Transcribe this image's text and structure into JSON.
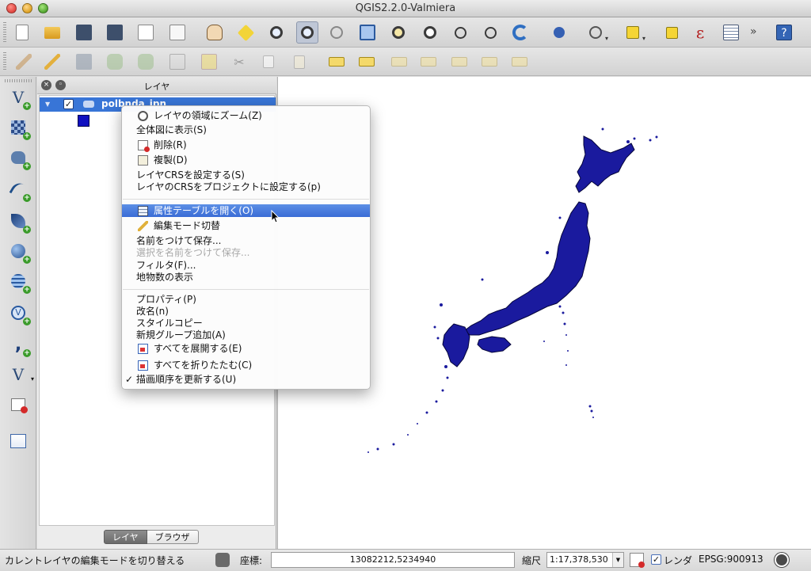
{
  "window": {
    "title": "QGIS2.2.0-Valmiera"
  },
  "toolbar1": {
    "buttons": [
      "new-project",
      "open-project",
      "save-project",
      "save-project-as",
      "new-print-composer",
      "composer-manager",
      "pan",
      "pan-to-selection",
      "zoom-in",
      "zoom-out",
      "zoom-actual-size",
      "zoom-full",
      "zoom-to-layer",
      "zoom-to-selection",
      "zoom-last",
      "zoom-next",
      "refresh",
      "identify",
      "map-tips",
      "select-features",
      "deselect-all",
      "field-calculator",
      "attribute-table",
      "help"
    ],
    "overflow": "»"
  },
  "toolbar2": {
    "buttons": [
      "current-edits",
      "toggle-editing",
      "save-layer-edits",
      "add-feature",
      "move-feature",
      "node-tool",
      "delete-selected",
      "cut-features",
      "copy-features",
      "paste-features",
      "label-toolbar",
      "pin-labels",
      "show-hide-labels",
      "move-label",
      "rotate-label",
      "change-label"
    ]
  },
  "vtoolbar": {
    "buttons": [
      "add-vector-layer",
      "add-raster-layer",
      "add-postgis-layer",
      "add-spatialite-layer",
      "add-mssql-layer",
      "add-wms-layer",
      "add-wcs-layer",
      "add-wfs-layer",
      "add-delimited-text-layer",
      "new-vector-layer",
      "remove-layer",
      "gps-tools"
    ]
  },
  "layers_panel": {
    "title": "レイヤ",
    "layer_name": "polbnda_jpn",
    "layer_checked": "✓",
    "tabs": [
      "レイヤ",
      "ブラウザ"
    ],
    "symbol_color": "#1010c0"
  },
  "context_menu": {
    "items": [
      {
        "label": "レイヤの領域にズーム(Z)",
        "icon": "zoom-layer-icon"
      },
      {
        "label": "全体図に表示(S)"
      },
      {
        "label": "削除(R)",
        "icon": "remove-icon"
      },
      {
        "label": "複製(D)",
        "icon": "duplicate-icon"
      },
      {
        "label": "レイヤCRSを設定する(S)"
      },
      {
        "label": "レイヤのCRSをプロジェクトに設定する(p)"
      },
      {
        "label": "属性テーブルを開く(O)",
        "icon": "table-icon",
        "highlighted": true
      },
      {
        "label": "編集モード切替",
        "icon": "pencil-icon"
      },
      {
        "label": "名前をつけて保存..."
      },
      {
        "label": "選択を名前をつけて保存...",
        "disabled": true
      },
      {
        "label": "フィルタ(F)..."
      },
      {
        "label": "地物数の表示"
      },
      {
        "label": "プロパティ(P)"
      },
      {
        "label": "改名(n)"
      },
      {
        "label": "スタイルコピー"
      },
      {
        "label": "新規グループ追加(A)"
      },
      {
        "label": "すべてを展開する(E)",
        "icon": "expand-all-icon"
      },
      {
        "label": "すべてを折りたたむ(C)",
        "icon": "collapse-all-icon"
      },
      {
        "label": "描画順序を更新する(U)",
        "checked": "✓"
      }
    ]
  },
  "map": {
    "fill_color": "#1a1a9e",
    "outline_color": "#05053a"
  },
  "statusbar": {
    "message": "カレントレイヤの編集モードを切り替える",
    "coordinate_label": "座標:",
    "coordinate_value": "13082212,5234940",
    "scale_label": "縮尺",
    "scale_value": "1:17,378,530",
    "render_label": "レンダ",
    "render_checked": "✓",
    "crs": "EPSG:900913"
  }
}
